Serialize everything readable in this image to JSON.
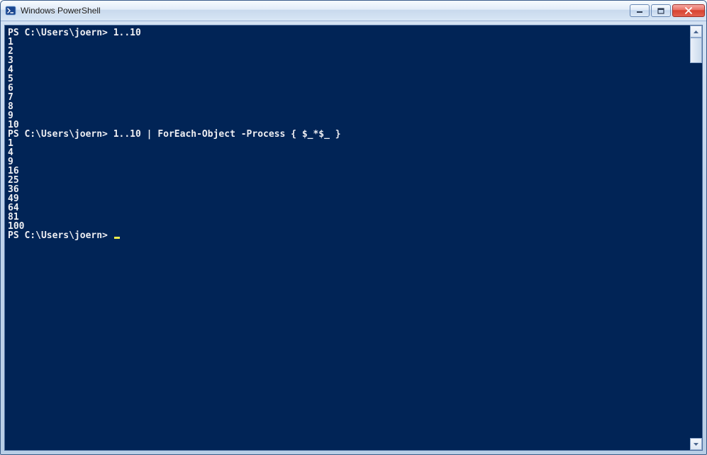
{
  "window": {
    "title": "Windows PowerShell"
  },
  "terminal": {
    "prompt": "PS C:\\Users\\joern> ",
    "lines": [
      {
        "type": "command",
        "text": "PS C:\\Users\\joern> 1..10"
      },
      {
        "type": "output",
        "text": "1"
      },
      {
        "type": "output",
        "text": "2"
      },
      {
        "type": "output",
        "text": "3"
      },
      {
        "type": "output",
        "text": "4"
      },
      {
        "type": "output",
        "text": "5"
      },
      {
        "type": "output",
        "text": "6"
      },
      {
        "type": "output",
        "text": "7"
      },
      {
        "type": "output",
        "text": "8"
      },
      {
        "type": "output",
        "text": "9"
      },
      {
        "type": "output",
        "text": "10"
      },
      {
        "type": "command",
        "text": "PS C:\\Users\\joern> 1..10 | ForEach-Object -Process { $_*$_ }"
      },
      {
        "type": "output",
        "text": "1"
      },
      {
        "type": "output",
        "text": "4"
      },
      {
        "type": "output",
        "text": "9"
      },
      {
        "type": "output",
        "text": "16"
      },
      {
        "type": "output",
        "text": "25"
      },
      {
        "type": "output",
        "text": "36"
      },
      {
        "type": "output",
        "text": "49"
      },
      {
        "type": "output",
        "text": "64"
      },
      {
        "type": "output",
        "text": "81"
      },
      {
        "type": "output",
        "text": "100"
      },
      {
        "type": "prompt",
        "text": "PS C:\\Users\\joern> "
      }
    ]
  }
}
